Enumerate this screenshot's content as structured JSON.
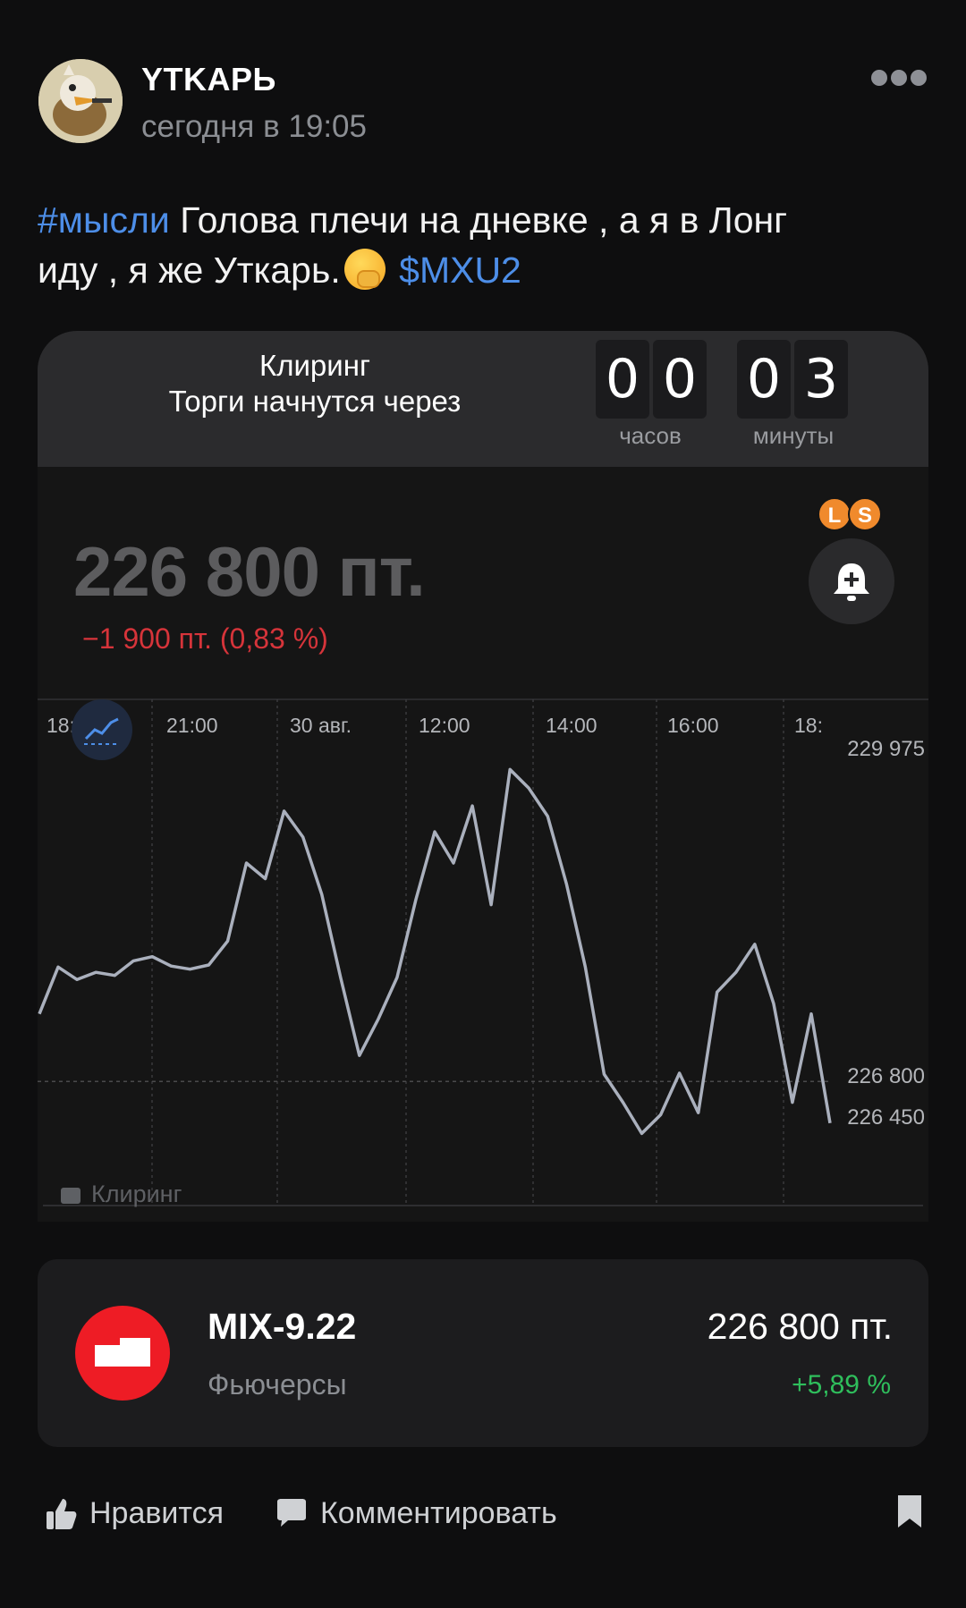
{
  "post": {
    "author": "YTKAPЬ",
    "time": "сегодня в 19:05",
    "hashtag": "#мысли",
    "text_line1": " Голова плечи на дневке , а я в Лонг",
    "text_line2": "иду , я же Уткарь.",
    "ticker": "$MXU2",
    "emoji_icon": "face-with-hand-over-mouth-emoji"
  },
  "widget": {
    "clearing_title": "Клиринг",
    "clearing_subtitle": "Торги начнутся через",
    "timer": {
      "hours_digits": [
        "0",
        "0"
      ],
      "minutes_digits": [
        "0",
        "3"
      ],
      "hours_label": "часов",
      "minutes_label": "минуты"
    },
    "price": "226 800 пт.",
    "change": "−1 900 пт. (0,83 %)",
    "badges": [
      "L",
      "S"
    ],
    "lock_label": "Клиринг",
    "colors": {
      "line": "#aab0bd",
      "down": "#d6343a",
      "up": "#2fbe5c",
      "badge": "#f08a2c"
    }
  },
  "chart_data": {
    "type": "line",
    "x_ticks": [
      "18:00",
      "21:00",
      "30 авг.",
      "12:00",
      "14:00",
      "16:00",
      "18:"
    ],
    "y_ticks": [
      229975,
      226800,
      226450
    ],
    "y_tick_labels": [
      "229 975",
      "226 800",
      "226 450"
    ],
    "ylim": [
      226450,
      229975
    ],
    "current_value": 226800,
    "grid": "vertical-dotted",
    "series": [
      {
        "values": [
          227450,
          227900,
          227780,
          227850,
          227820,
          227960,
          228000,
          227910,
          227880,
          227920,
          228150,
          228900,
          228750,
          229400,
          229150,
          228600,
          227800,
          227050,
          227400,
          227800,
          228550,
          229200,
          228900,
          229450,
          228500,
          229800,
          229620,
          229350,
          228700,
          227900,
          226870,
          226600,
          226300,
          226480,
          226880,
          226500,
          227660,
          227850,
          228120,
          227550,
          226600,
          227450,
          226400
        ]
      }
    ]
  },
  "card": {
    "name": "MIX-9.22",
    "type": "Фьючерсы",
    "price": "226 800  пт.",
    "change": "+5,89 %"
  },
  "actions": {
    "like_label": "Нравится",
    "comment_label": "Комментировать"
  }
}
